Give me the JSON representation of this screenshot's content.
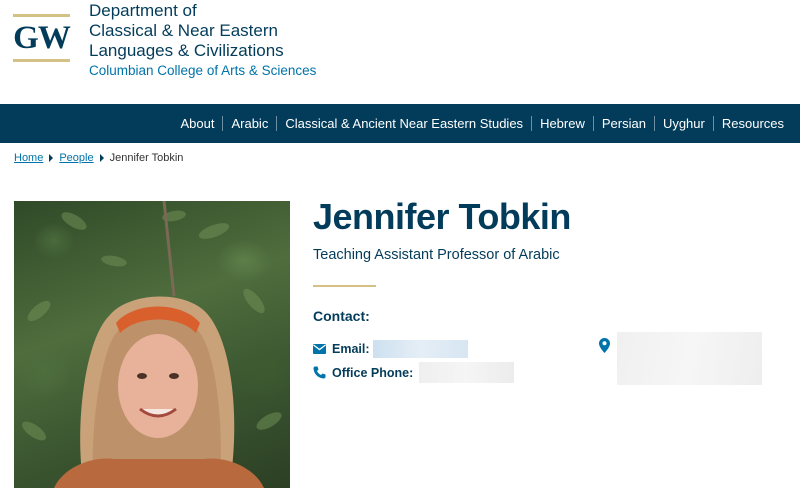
{
  "header": {
    "logo_text": "GW",
    "department_lines": [
      "Department of",
      "Classical & Near Eastern",
      "Languages & Civilizations"
    ],
    "college": "Columbian College of Arts & Sciences"
  },
  "nav": {
    "items": [
      "About",
      "Arabic",
      "Classical & Ancient Near Eastern Studies",
      "Hebrew",
      "Persian",
      "Uyghur",
      "Resources"
    ]
  },
  "breadcrumb": {
    "home": "Home",
    "people": "People",
    "current": "Jennifer Tobkin"
  },
  "profile": {
    "name": "Jennifer Tobkin",
    "title": "Teaching Assistant Professor of Arabic",
    "contact_heading": "Contact:",
    "email_label": "Email:",
    "phone_label": "Office Phone:"
  },
  "colors": {
    "navy": "#033c5a",
    "link_blue": "#0073aa",
    "gold": "#d5c086"
  },
  "icons": [
    "envelope-icon",
    "phone-icon",
    "map-pin-icon",
    "caret-right-icon"
  ]
}
